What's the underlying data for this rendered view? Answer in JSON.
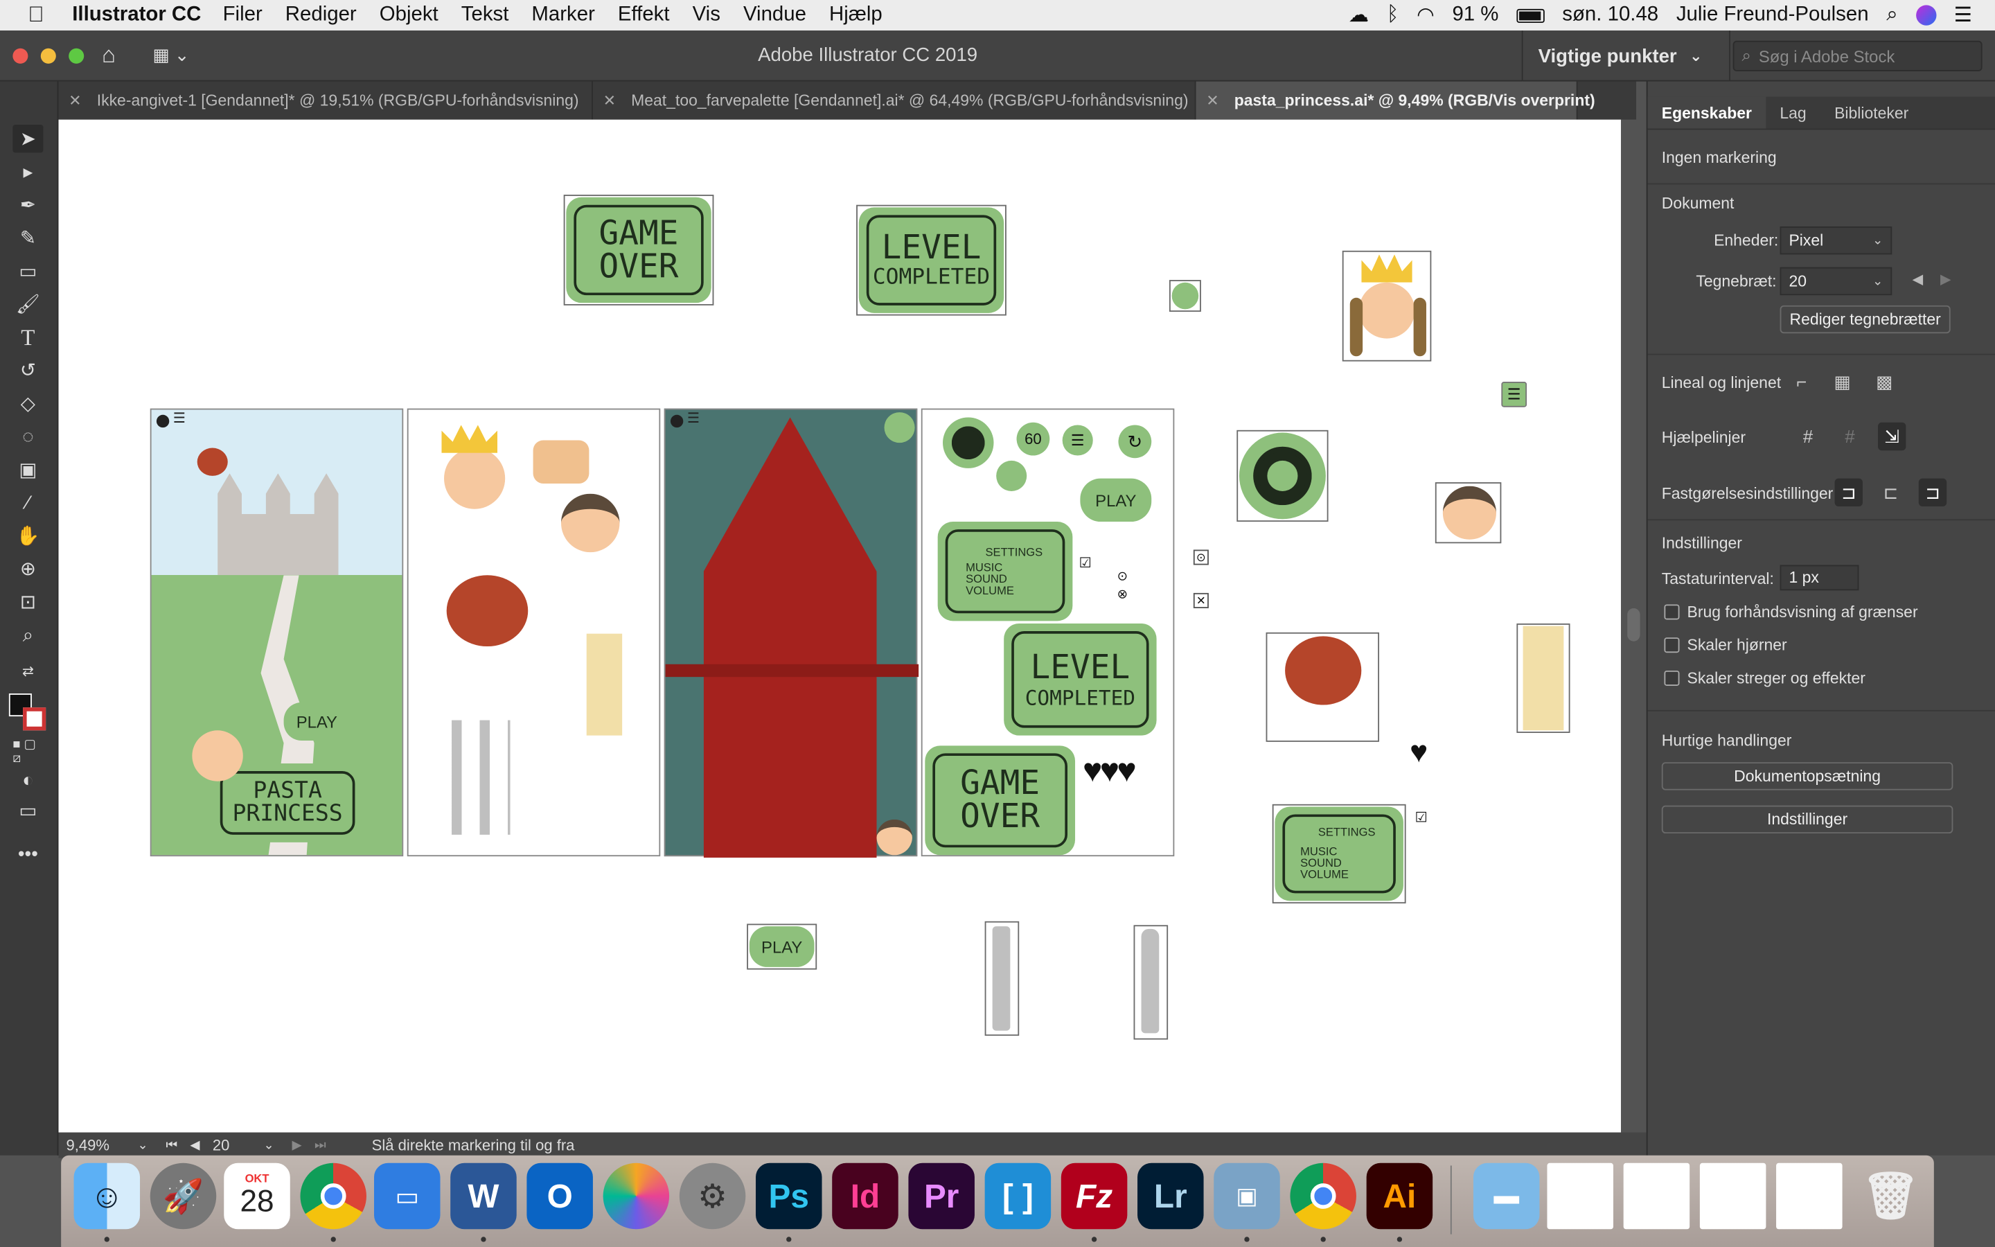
{
  "menubar": {
    "apple": "",
    "app_name": "Illustrator CC",
    "items": [
      "Filer",
      "Rediger",
      "Objekt",
      "Tekst",
      "Marker",
      "Effekt",
      "Vis",
      "Vindue",
      "Hjælp"
    ],
    "battery": "91 %",
    "clock": "søn. 10.48",
    "user": "Julie Freund-Poulsen"
  },
  "titlebar": {
    "title": "Adobe Illustrator CC 2019",
    "workspace": "Vigtige punkter",
    "stock_placeholder": "Søg i Adobe Stock"
  },
  "tabs": [
    {
      "label": "Ikke-angivet-1 [Gendannet]* @ 19,51% (RGB/GPU-forhåndsvisning)",
      "active": false
    },
    {
      "label": "Meat_too_farvepalette [Gendannet].ai* @ 64,49% (RGB/GPU-forhåndsvisning)",
      "active": false
    },
    {
      "label": "pasta_princess.ai* @ 9,49% (RGB/Vis overprint)",
      "active": true
    }
  ],
  "status": {
    "zoom": "9,49%",
    "artboard": "20",
    "hint": "Slå direkte markering til og fra"
  },
  "panel": {
    "tabs": [
      "Egenskaber",
      "Lag",
      "Biblioteker"
    ],
    "no_selection": "Ingen markering",
    "document_heading": "Dokument",
    "units_label": "Enheder:",
    "units_value": "Pixel",
    "artboard_label": "Tegnebræt:",
    "artboard_value": "20",
    "edit_artboards": "Rediger tegnebrætter",
    "rulers_label": "Lineal og linjenet",
    "guides_label": "Hjælpelinjer",
    "snap_label": "Fastgørelsesindstillinger",
    "prefs_heading": "Indstillinger",
    "keyboard_label": "Tastaturinterval:",
    "keyboard_value": "1 px",
    "checkboxes": [
      "Brug forhåndsvisning af grænser",
      "Skaler hjørner",
      "Skaler streger og effekter"
    ],
    "quick_heading": "Hurtige handlinger",
    "quick_buttons": [
      "Dokumentopsætning",
      "Indstillinger"
    ]
  },
  "artwork": {
    "game_over_line1": "GAME",
    "game_over_line2": "OVER",
    "level_line1": "LEVEL",
    "level_line2": "COMPLETED",
    "play": "PLAY",
    "pasta_line1": "PASTA",
    "pasta_line2": "PRINCESS",
    "settings_title": "SETTINGS",
    "settings_items": [
      "MUSIC",
      "SOUND",
      "VOLUME"
    ],
    "timer": "60",
    "hearts": "♥♥♥",
    "heart": "♥"
  },
  "dock": {
    "calendar_month": "OKT",
    "calendar_day": "28",
    "apps": [
      "Finder",
      "Launchpad",
      "Kalender",
      "Chrome",
      "Keynote",
      "Word",
      "Outlook",
      "Fotos",
      "Systemindstillinger",
      "Ps",
      "Id",
      "Pr",
      "Brackets",
      "FileZilla",
      "Lr",
      "Preview",
      "Chrome",
      "Ai"
    ]
  },
  "colors": {
    "green": "#8ec07c",
    "dark_teal": "#4a7470",
    "red_door": "#a5221e"
  }
}
